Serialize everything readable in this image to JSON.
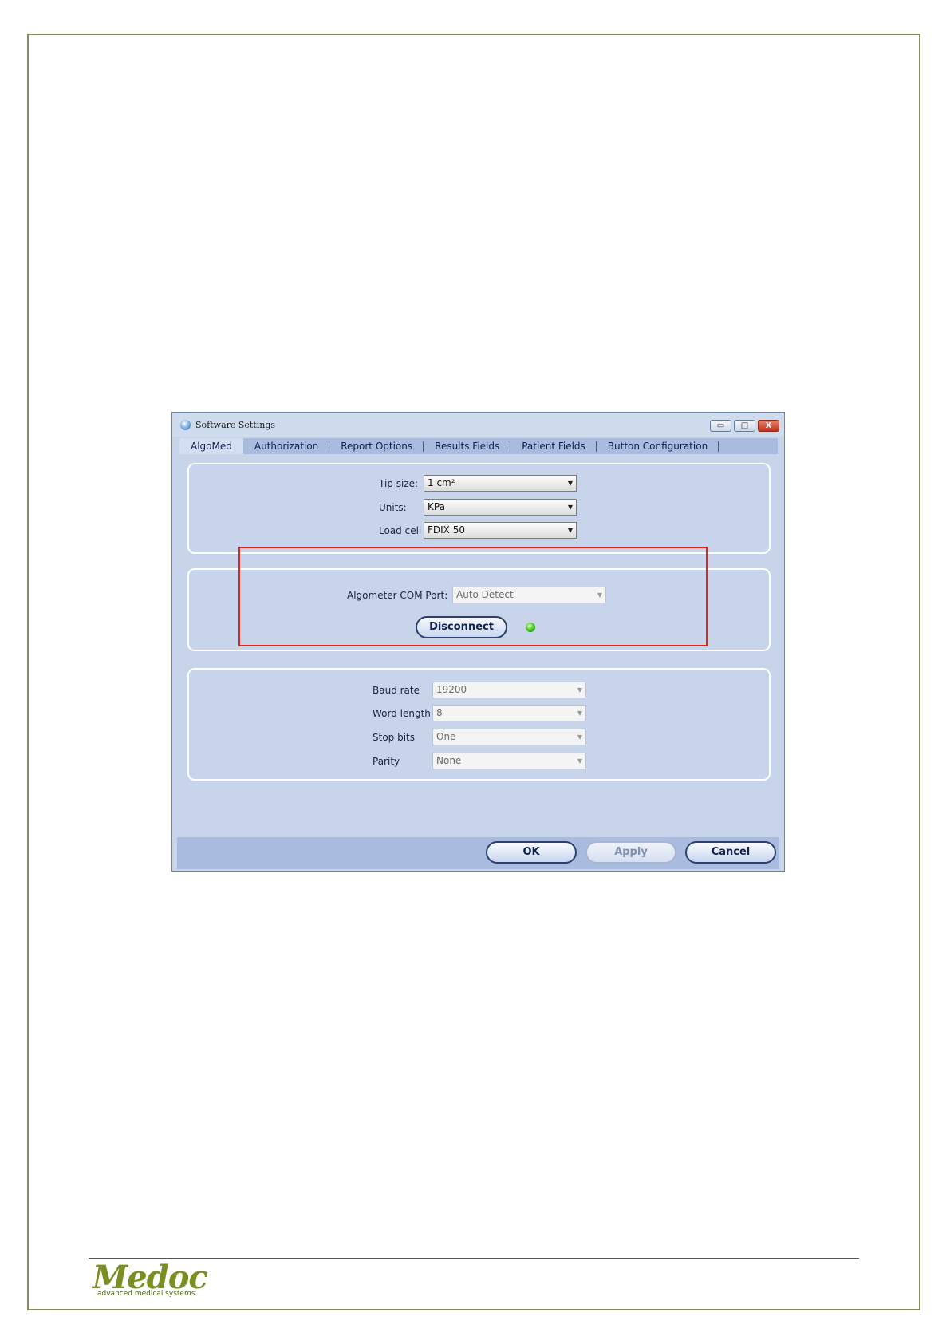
{
  "footer": {
    "logo_word": "Medoc",
    "logo_tagline": "advanced medical systems"
  },
  "window": {
    "title": "Software Settings",
    "app_icon": "settings-app-icon",
    "controls": {
      "minimize": "▭",
      "maximize": "□",
      "close": "X"
    }
  },
  "tabs": [
    {
      "label": "AlgoMed"
    },
    {
      "label": "Authorization"
    },
    {
      "label": "Report Options"
    },
    {
      "label": "Results Fields"
    },
    {
      "label": "Patient Fields"
    },
    {
      "label": "Button Configuration"
    }
  ],
  "device": {
    "tip_size_label": "Tip size:",
    "tip_size_value": "1 cm²",
    "units_label": "Units:",
    "units_value": "KPa",
    "load_cell_label": "Load cell",
    "load_cell_value": "FDIX 50"
  },
  "connection": {
    "com_port_label": "Algometer COM Port:",
    "com_port_value": "Auto Detect",
    "disconnect_label": "Disconnect",
    "status_color": "#3bbf17"
  },
  "serial": {
    "baud_rate_label": "Baud rate",
    "baud_rate_value": "19200",
    "word_length_label": "Word length",
    "word_length_value": "8",
    "stop_bits_label": "Stop bits",
    "stop_bits_value": "One",
    "parity_label": "Parity",
    "parity_value": "None"
  },
  "buttons": {
    "ok": "OK",
    "apply": "Apply",
    "cancel": "Cancel"
  },
  "colors": {
    "highlight": "#e2231a",
    "window_bg": "#c7d4ea",
    "tab_bar": "#a9bce0"
  }
}
